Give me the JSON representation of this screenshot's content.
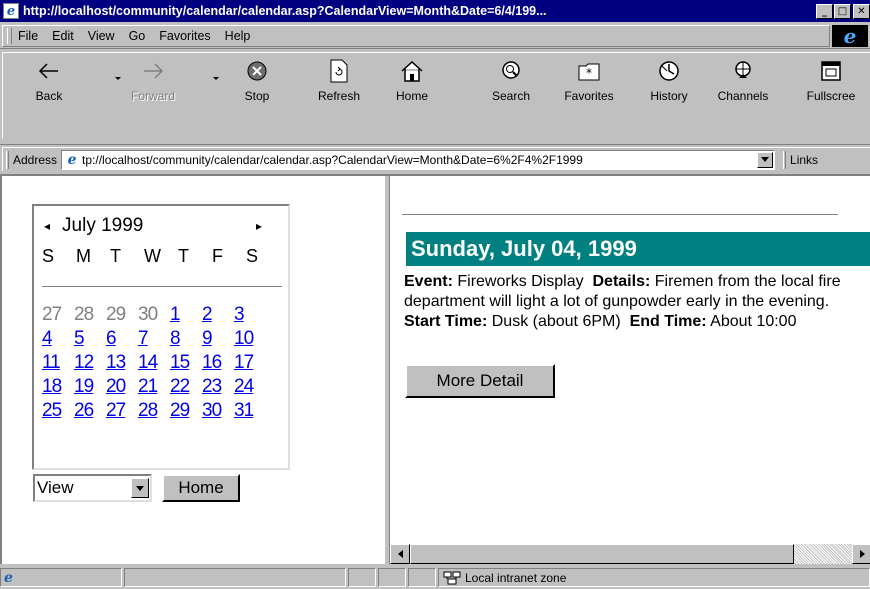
{
  "window": {
    "title": "http://localhost/community/calendar/calendar.asp?CalendarView=Month&Date=6/4/199...",
    "minimize_glyph": "_",
    "maximize_glyph": "□",
    "close_glyph": "✕"
  },
  "menu": {
    "items": [
      "File",
      "Edit",
      "View",
      "Go",
      "Favorites",
      "Help"
    ]
  },
  "toolbar": {
    "buttons": [
      {
        "label": "Back",
        "icon": "back-arrow-icon",
        "enabled": true
      },
      {
        "label": "Forward",
        "icon": "forward-arrow-icon",
        "enabled": false
      },
      {
        "label": "Stop",
        "icon": "stop-icon",
        "enabled": true
      },
      {
        "label": "Refresh",
        "icon": "refresh-icon",
        "enabled": true
      },
      {
        "label": "Home",
        "icon": "home-icon",
        "enabled": true
      },
      {
        "label": "Search",
        "icon": "search-icon",
        "enabled": true
      },
      {
        "label": "Favorites",
        "icon": "favorites-icon",
        "enabled": true
      },
      {
        "label": "History",
        "icon": "history-icon",
        "enabled": true
      },
      {
        "label": "Channels",
        "icon": "channels-icon",
        "enabled": true
      },
      {
        "label": "Fullscree",
        "icon": "fullscreen-icon",
        "enabled": true
      }
    ]
  },
  "address": {
    "label": "Address",
    "value": "tp://localhost/community/calendar/calendar.asp?CalendarView=Month&Date=6%2F4%2F1999",
    "links_label": "Links"
  },
  "calendar": {
    "prev": "◂",
    "next": "▸",
    "month_label": "July 1999",
    "weekdays": [
      "S",
      "M",
      "T",
      "W",
      "T",
      "F",
      "S"
    ],
    "weeks": [
      [
        {
          "d": "27",
          "t": "other"
        },
        {
          "d": "28",
          "t": "other"
        },
        {
          "d": "29",
          "t": "other"
        },
        {
          "d": "30",
          "t": "other"
        },
        {
          "d": "1",
          "t": "link"
        },
        {
          "d": "2",
          "t": "link"
        },
        {
          "d": "3",
          "t": "link"
        }
      ],
      [
        {
          "d": "4",
          "t": "link"
        },
        {
          "d": "5",
          "t": "link"
        },
        {
          "d": "6",
          "t": "link"
        },
        {
          "d": "7",
          "t": "link"
        },
        {
          "d": "8",
          "t": "link"
        },
        {
          "d": "9",
          "t": "link"
        },
        {
          "d": "10",
          "t": "link"
        }
      ],
      [
        {
          "d": "11",
          "t": "link"
        },
        {
          "d": "12",
          "t": "link"
        },
        {
          "d": "13",
          "t": "link"
        },
        {
          "d": "14",
          "t": "link"
        },
        {
          "d": "15",
          "t": "link"
        },
        {
          "d": "16",
          "t": "link"
        },
        {
          "d": "17",
          "t": "link"
        }
      ],
      [
        {
          "d": "18",
          "t": "link"
        },
        {
          "d": "19",
          "t": "link"
        },
        {
          "d": "20",
          "t": "link"
        },
        {
          "d": "21",
          "t": "link"
        },
        {
          "d": "22",
          "t": "link"
        },
        {
          "d": "23",
          "t": "link"
        },
        {
          "d": "24",
          "t": "link"
        }
      ],
      [
        {
          "d": "25",
          "t": "link"
        },
        {
          "d": "26",
          "t": "link"
        },
        {
          "d": "27",
          "t": "link"
        },
        {
          "d": "28",
          "t": "link"
        },
        {
          "d": "29",
          "t": "link"
        },
        {
          "d": "30",
          "t": "link"
        },
        {
          "d": "31",
          "t": "link"
        }
      ]
    ],
    "view_select_value": "View",
    "home_button": "Home"
  },
  "event": {
    "header": "Sunday, July 04, 1999",
    "event_label": "Event:",
    "event_value": "Fireworks Display",
    "details_label": "Details:",
    "details_value": "Firemen from the local fire department will light a lot of gunpowder early in the evening.",
    "start_label": "Start Time:",
    "start_value": "Dusk (about 6PM)",
    "end_label": "End Time:",
    "end_value": "About 10:00",
    "more_button": "More Detail"
  },
  "status": {
    "zone": "Local intranet zone"
  },
  "colors": {
    "titlebar": "#000080",
    "event_header": "#008080",
    "link": "#0000ee",
    "chrome": "#c0c0c0"
  }
}
